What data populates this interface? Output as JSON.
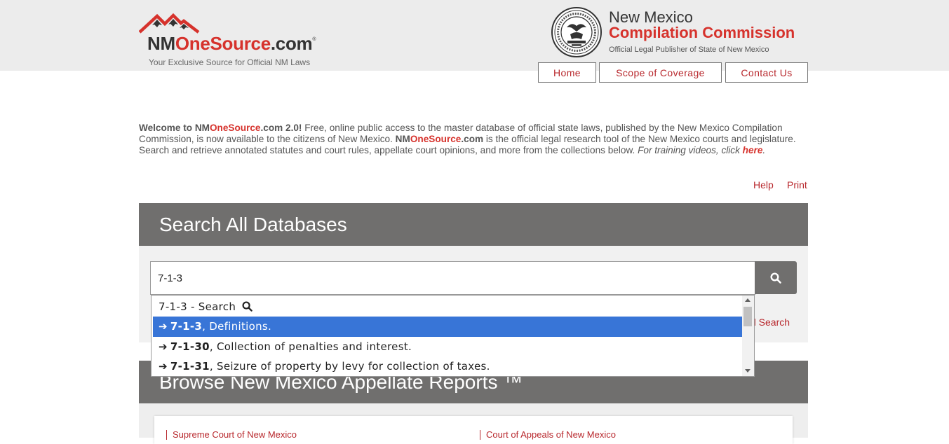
{
  "header": {
    "logo": {
      "prefix": "NM",
      "accent": "OneSource",
      "suffix": ".com",
      "registered": "®",
      "tagline": "Your Exclusive Source for Official NM Laws"
    },
    "commission": {
      "line1": "New Mexico",
      "line2": "Compilation Commission",
      "line3": "Official Legal Publisher of State of New Mexico"
    },
    "nav": [
      {
        "label": "Home"
      },
      {
        "label": "Scope of Coverage"
      },
      {
        "label": "Contact Us"
      }
    ]
  },
  "welcome": {
    "lead_a": "Welcome to NM",
    "lead_b": "OneSource",
    "lead_c": ".com 2.0!",
    "body1": "  Free, online public access to the master database of official state laws, published by the New Mexico Compilation Commission, is now available to the citizens of New Mexico.  ",
    "brand_a": "NM",
    "brand_b": "OneSource",
    "brand_c": ".com",
    "body2": " is the official legal research tool of the New Mexico courts and legislature.  Search and retrieve annotated statutes and court rules, appellate court opinions, and more from the collections below.  ",
    "italic": "For training videos, click ",
    "link": "here",
    "end": "."
  },
  "utility": {
    "help": "Help",
    "print": "Print"
  },
  "search": {
    "title": "Search All Databases",
    "value": "7-1-3",
    "advanced_link": "d Search",
    "suggestions": {
      "search_row": "7-1-3 - Search",
      "items": [
        {
          "bold": "7-1-3",
          "rest": ", Definitions.",
          "selected": true
        },
        {
          "bold": "7-1-30",
          "rest": ", Collection of penalties and interest.",
          "selected": false
        },
        {
          "bold": "7-1-31",
          "rest": ", Seizure of property by levy for collection of taxes.",
          "selected": false
        }
      ]
    }
  },
  "browse": {
    "title": "Browse New Mexico Appellate Reports ™",
    "left": "Supreme Court of New Mexico",
    "right": "Court of Appeals of New Mexico"
  },
  "colors": {
    "brand_red": "#d6322c",
    "link_red": "#b8282d",
    "panel_gray": "#706f6e",
    "selection_blue": "#3875d7"
  },
  "icons": {
    "search_button": "search-icon",
    "search_row": "search-icon",
    "suggestion": "arrow-right-icon",
    "seal": "state-seal-icon",
    "logo": "mountain-logo-icon"
  }
}
